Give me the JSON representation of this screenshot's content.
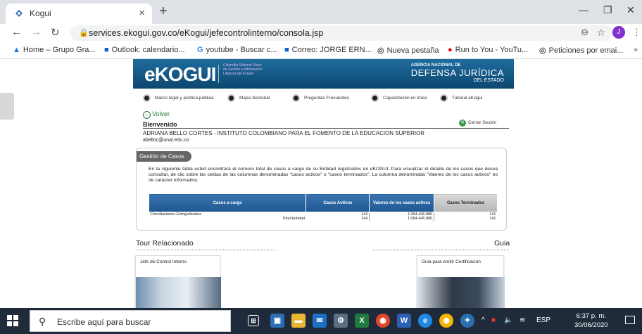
{
  "browser": {
    "tab_title": "Kogui",
    "tab_close": "×",
    "new_tab": "+",
    "url": "services.ekogui.gov.co/eKogui/jefecontrolinterno/consola.jsp",
    "avatar_letter": "J",
    "bookmarks": [
      {
        "icon": "drive-icon",
        "label": "Home – Grupo Gra..."
      },
      {
        "icon": "outlook-icon",
        "label": "Outlook: calendario..."
      },
      {
        "icon": "google-icon",
        "label": "youtube - Buscar c..."
      },
      {
        "icon": "outlook-icon",
        "label": "Correo: JORGE ERN..."
      },
      {
        "icon": "globe-icon",
        "label": "Nueva pestaña"
      },
      {
        "icon": "youtube-icon",
        "label": "Run to You - YouTu..."
      },
      {
        "icon": "globe-icon",
        "label": "Peticiones por emai..."
      }
    ],
    "more_bookmarks": "»"
  },
  "site": {
    "logo_text": "eKOGUI",
    "logo_subtitle": "Colombia Sistema Único de Gestión e Información Litigiosa del Estado",
    "agency_line1": "AGENCIA NACIONAL DE",
    "agency_line2": "DEFENSA JURÍDICA",
    "agency_line3": "DEL ESTADO",
    "menu": [
      {
        "icon": "scale-icon",
        "label": "Marco legal y política pública"
      },
      {
        "icon": "map-icon",
        "label": "Mapa Sectorial"
      },
      {
        "icon": "question-icon",
        "label": "Preguntas Frecuentes"
      },
      {
        "icon": "info-icon",
        "label": "Capacitación en línea"
      },
      {
        "icon": "help-icon",
        "label": "Tutorial eKogui"
      }
    ],
    "volver": "Volver",
    "bienvenido": "Bienvenido",
    "cerrar_sesion": "Cerrar Sesión",
    "user_line": "ADRIANA BELLO CORTES - INSTITUTO COLOMBIANO PARA EL FOMENTO DE LA EDUCACION SUPERIOR",
    "email": "abelloc@unal.edu.co"
  },
  "gestion": {
    "tab_label": "Gestión de Casos",
    "description": "En la siguiente tabla usted encontrará el número total de casos a cargo de su Entidad registrados en eKOGUI. Para visualizar el detalle de los casos que desea consultar, de clic sobre las celdas de las columnas denominadas \"casos activos\" o \"casos terminados\". La columna denominada \"Valores de los casos activos\" es de carácter informativo.",
    "headers": [
      "Casos a cargo",
      "Casos Activos",
      "Valores de los casos activos",
      "Casos Terminados"
    ],
    "rows": [
      {
        "label": "Conciliaciones Extrajudiciales",
        "activos": "144",
        "valores": "1.064.446.880",
        "terminados": "141"
      },
      {
        "label": "Total Entidad",
        "activos": "144",
        "valores": "1.064.446.880",
        "terminados": "141"
      }
    ]
  },
  "tour": {
    "heading": "Tour Relacionado",
    "guia_heading": "Guia",
    "card1_title": "Jefe de Control Interno",
    "card2_title": "Guia para emitir Certificación"
  },
  "taskbar": {
    "search_placeholder": "Escribe aquí para buscar",
    "lang": "ESP",
    "time": "6:37 p. m.",
    "date": "30/06/2020"
  }
}
